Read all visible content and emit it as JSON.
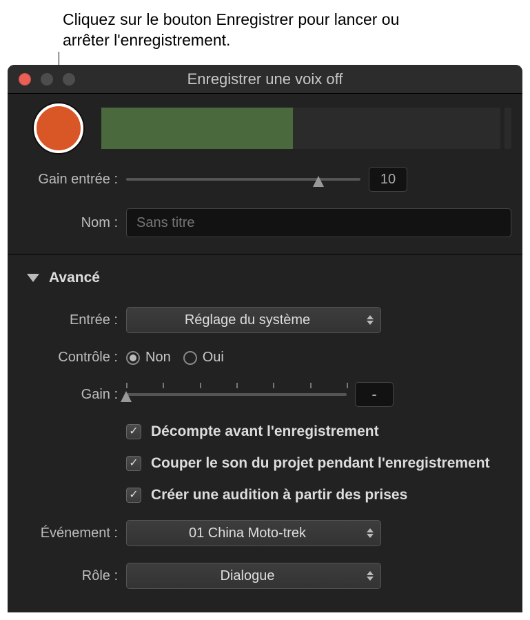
{
  "callout": "Cliquez sur le bouton Enregistrer pour lancer ou arrêter l'enregistrement.",
  "window": {
    "title": "Enregistrer une voix off"
  },
  "main": {
    "input_gain_label": "Gain entrée :",
    "input_gain_value": "10",
    "name_label": "Nom :",
    "name_placeholder": "Sans titre"
  },
  "advanced": {
    "section_title": "Avancé",
    "input_label": "Entrée :",
    "input_value": "Réglage du système",
    "monitor_label": "Contrôle :",
    "monitor_off": "Non",
    "monitor_on": "Oui",
    "gain_label": "Gain :",
    "gain_value": "-",
    "checkbox_countdown": "Décompte avant l'enregistrement",
    "checkbox_mute": "Couper le son du projet pendant l'enregistrement",
    "checkbox_audition": "Créer une audition à partir des prises",
    "event_label": "Événement :",
    "event_value": "01 China Moto-trek",
    "role_label": "Rôle :",
    "role_value": "Dialogue"
  }
}
